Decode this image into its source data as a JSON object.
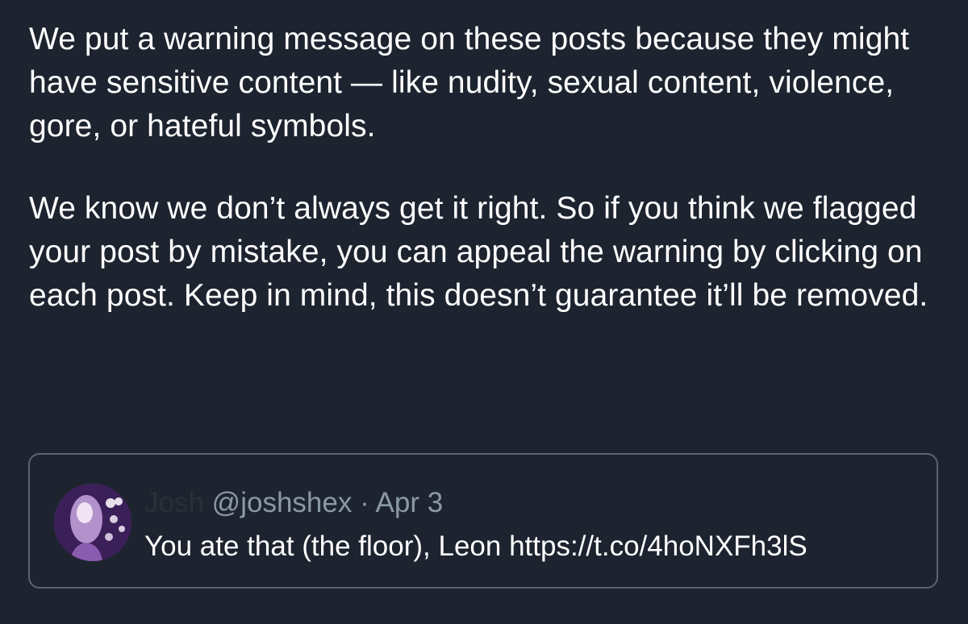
{
  "notice": {
    "paragraph_1": "We put a warning message on these posts because they might have sensitive content — like nudity, sexual content, violence, gore, or hateful symbols.",
    "paragraph_2": "We know we don’t always get it right. So if you think we flagged your post by mistake, you can appeal the warning by clicking on each post. Keep in mind, this doesn’t guarantee it’ll be removed."
  },
  "tweet": {
    "author_name": "Josh",
    "handle": "@joshshex",
    "separator": "·",
    "date": "Apr 3",
    "text": "You ate that (the floor), Leon https://t.co/4hoNXFh3lS"
  },
  "colors": {
    "background": "#1d2430",
    "text": "#ffffff",
    "muted": "#8b98a5",
    "card_border": "#5b6472"
  }
}
